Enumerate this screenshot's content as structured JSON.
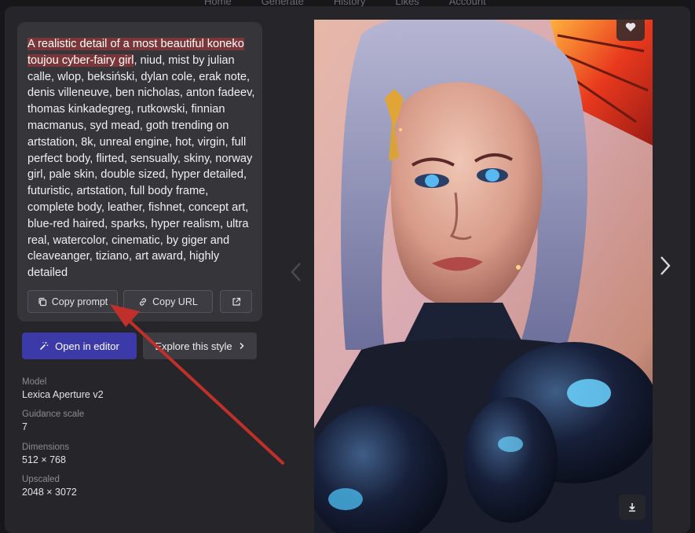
{
  "topnav": {
    "items": [
      "Home",
      "Generate",
      "History",
      "Likes",
      "Account"
    ]
  },
  "prompt": {
    "highlighted": "A realistic detail of a most beautiful koneko toujou cyber-fairy girl",
    "rest": ", niud, mist by julian calle, wlop, beksiński, dylan cole, erak note, denis villeneuve, ben nicholas, anton fadeev, thomas kinkadegreg, rutkowski, finnian macmanus, syd mead, goth trending on artstation, 8k, unreal engine, hot, virgin, full perfect body, flirted, sensually, skiny, norway girl, pale skin, double sized, hyper detailed, futuristic, artstation, full body frame, complete body, leather, fishnet, concept art, blue-red haired, sparks, hyper realism, ultra real, watercolor, cinematic, by giger and cleaveanger, tiziano, art award, highly detailed"
  },
  "actions": {
    "copy_prompt": "Copy prompt",
    "copy_url": "Copy URL",
    "open_in_editor": "Open in editor",
    "explore_style": "Explore this style"
  },
  "meta": {
    "model_label": "Model",
    "model_value": "Lexica Aperture v2",
    "guidance_label": "Guidance scale",
    "guidance_value": "7",
    "dimensions_label": "Dimensions",
    "dimensions_value": "512 × 768",
    "upscaled_label": "Upscaled",
    "upscaled_value": "2048 × 3072"
  },
  "icons": {
    "copy": "copy-icon",
    "link": "link-icon",
    "external": "external-link-icon",
    "editor": "magic-wand-icon",
    "chevron": "chevron-right-icon",
    "heart": "heart-icon",
    "download": "download-icon",
    "prev": "chevron-left-icon",
    "next": "chevron-right-icon"
  },
  "colors": {
    "primary_button": "#3b3aa8",
    "highlight": "#7a3638",
    "annotation_arrow": "#c0302a"
  }
}
